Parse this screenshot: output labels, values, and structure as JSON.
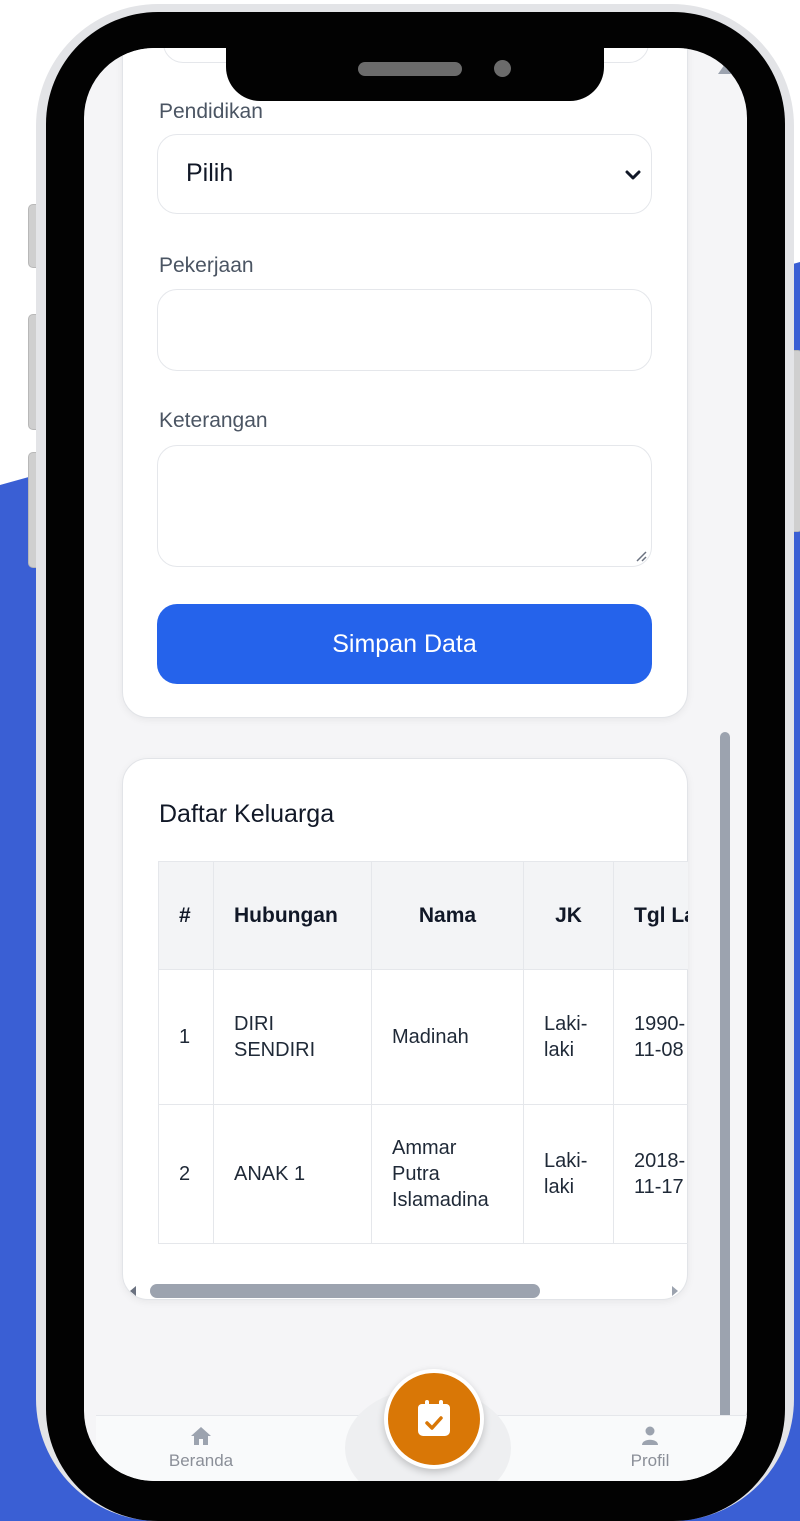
{
  "colors": {
    "background_blue": "#3a5fd4",
    "primary_button": "#2563eb",
    "fab": "#d97706"
  },
  "form": {
    "pendidikan_label": "Pendidikan",
    "pendidikan_value": "Pilih",
    "pekerjaan_label": "Pekerjaan",
    "pekerjaan_value": "",
    "keterangan_label": "Keterangan",
    "keterangan_value": "",
    "save_button": "Simpan Data"
  },
  "family": {
    "title": "Daftar Keluarga",
    "headers": [
      "#",
      "Hubungan",
      "Nama",
      "JK",
      "Tgl Lahir"
    ],
    "rows": [
      [
        "1",
        "DIRI SENDIRI",
        "Madinah",
        "Laki-laki",
        "1990-11-08"
      ],
      [
        "2",
        "ANAK 1",
        "Ammar Putra Islamadina",
        "Laki-laki",
        "2018-11-17"
      ]
    ]
  },
  "nav": {
    "home_label": "Beranda",
    "home_icon": "home-icon",
    "profile_label": "Profil",
    "profile_icon": "user-icon",
    "fab_icon": "calendar-check-icon"
  }
}
